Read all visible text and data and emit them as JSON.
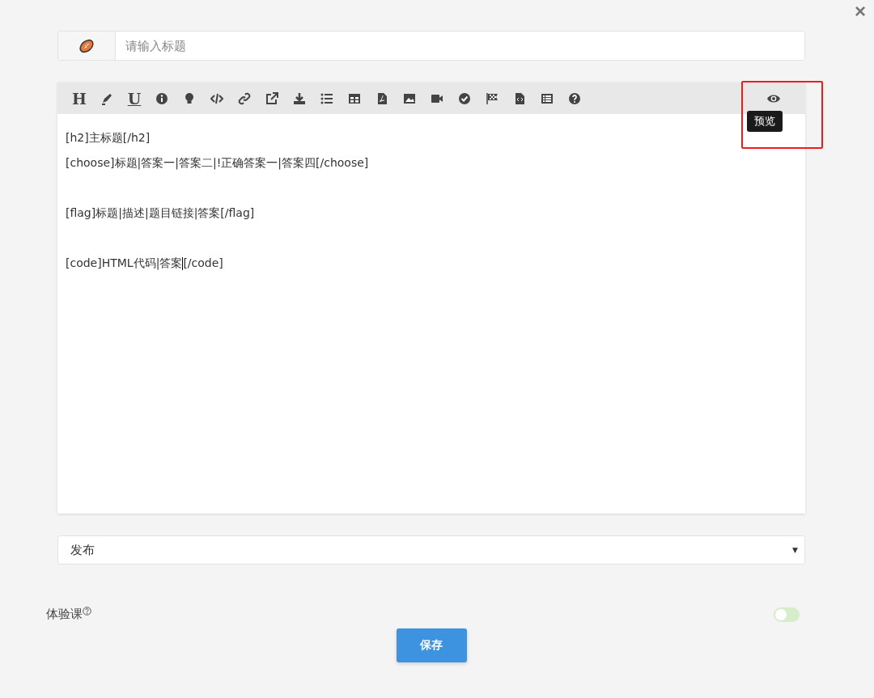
{
  "close": "×",
  "title_field": {
    "placeholder": "请输入标题"
  },
  "toolbar": [
    {
      "kind": "glyph",
      "text": "H"
    },
    {
      "kind": "icon"
    },
    {
      "kind": "glyph",
      "text": "U"
    },
    {
      "kind": "icon"
    },
    {
      "kind": "icon"
    },
    {
      "kind": "icon"
    },
    {
      "kind": "icon"
    },
    {
      "kind": "icon"
    },
    {
      "kind": "icon"
    },
    {
      "kind": "icon"
    },
    {
      "kind": "icon"
    },
    {
      "kind": "icon"
    },
    {
      "kind": "icon"
    },
    {
      "kind": "icon"
    },
    {
      "kind": "icon"
    },
    {
      "kind": "icon"
    },
    {
      "kind": "icon"
    },
    {
      "kind": "icon"
    },
    {
      "kind": "icon"
    }
  ],
  "preview": {
    "tooltip": "预览",
    "highlighted": true
  },
  "editor_lines": [
    {
      "text": "[h2]主标题[/h2]",
      "spaced": false
    },
    {
      "text": "[choose]标题|答案一|答案二|!正确答案一|答案四[/choose]",
      "spaced": false
    },
    {
      "text": "[flag]标题|描述|题目链接|答案[/flag]",
      "spaced": true
    },
    {
      "text": "[code]HTML代码|答案",
      "spaced": true,
      "cursor": true,
      "after_cursor": "[/code]"
    }
  ],
  "status_select": {
    "value": "发布",
    "arrow": "▼"
  },
  "trial": {
    "label": "体验课",
    "on": false
  },
  "save_button": "保存"
}
